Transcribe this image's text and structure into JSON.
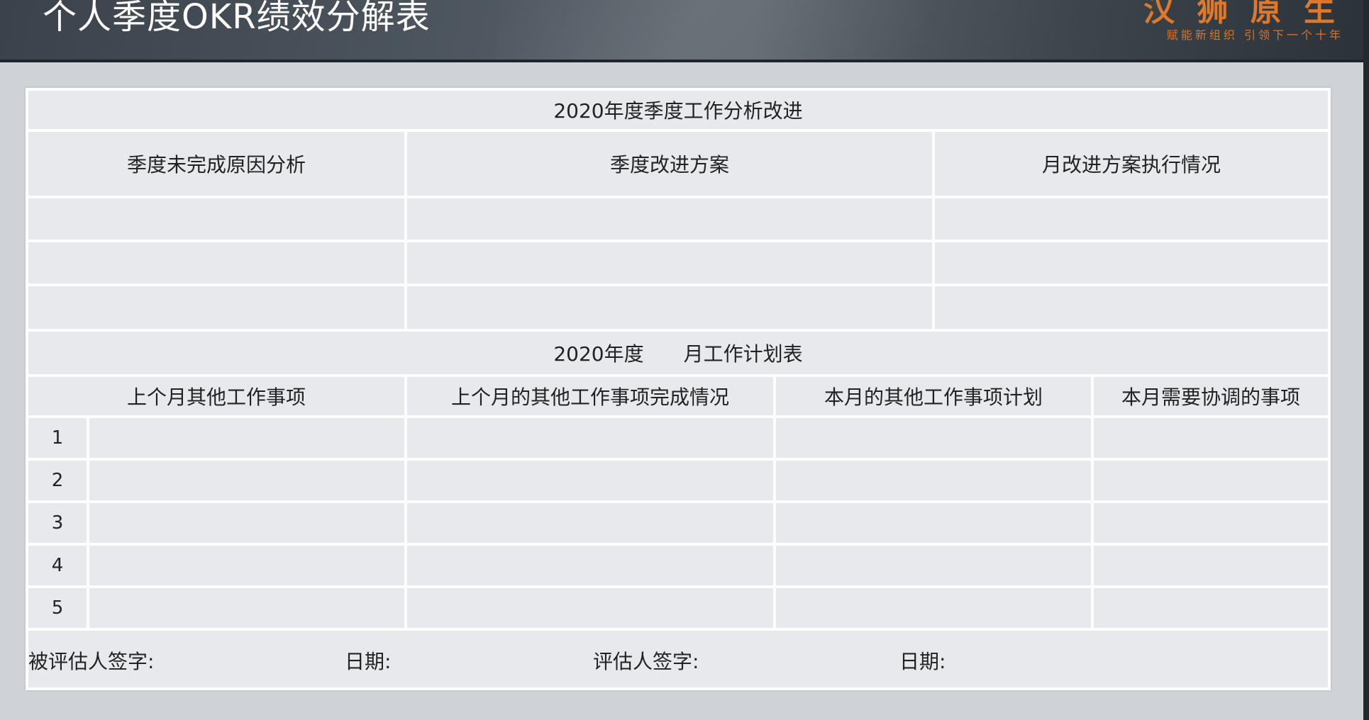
{
  "header": {
    "title": "个人季度OKR绩效分解表",
    "brand": "汉 狮 原 生",
    "slogan": "赋能新组织 引领下一个十年"
  },
  "section1": {
    "title": "2020年度季度工作分析改进",
    "columns": [
      "季度未完成原因分析",
      "季度改进方案",
      "月改进方案执行情况"
    ]
  },
  "section2": {
    "title": "2020年度　　月工作计划表",
    "columns": [
      "上个月其他工作事项",
      "上个月的其他工作事项完成情况",
      "本月的其他工作事项计划",
      "本月需要协调的事项"
    ],
    "row_numbers": [
      "1",
      "2",
      "3",
      "4",
      "5"
    ]
  },
  "signatures": {
    "appraisee_label": "被评估人签字:",
    "date_label_1": "日期:",
    "appraiser_label": "评估人签字:",
    "date_label_2": "日期:"
  }
}
